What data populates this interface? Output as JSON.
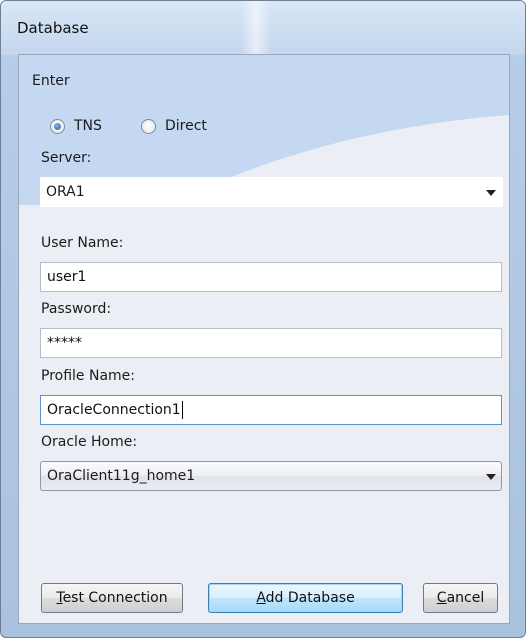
{
  "window": {
    "title": "Database"
  },
  "group": {
    "label": "Enter"
  },
  "mode": {
    "options": [
      {
        "label": "TNS",
        "selected": true
      },
      {
        "label": "Direct",
        "selected": false
      }
    ]
  },
  "server": {
    "label": "Server:",
    "value": "ORA1"
  },
  "username": {
    "label": "User Name:",
    "value": "user1"
  },
  "password": {
    "label": "Password:",
    "value": "*****"
  },
  "profile": {
    "label": "Profile Name:",
    "value": "OracleConnection1"
  },
  "oracle_home": {
    "label": "Oracle Home:",
    "value": "OraClient11g_home1"
  },
  "buttons": {
    "test": {
      "mnemonic": "T",
      "rest": "est Connection"
    },
    "add": {
      "mnemonic": "A",
      "rest": "dd Database"
    },
    "cancel": {
      "mnemonic": "C",
      "rest": "ancel"
    }
  },
  "colors": {
    "accent": "#3c7fb1",
    "window_frame": "#b6cde9"
  }
}
